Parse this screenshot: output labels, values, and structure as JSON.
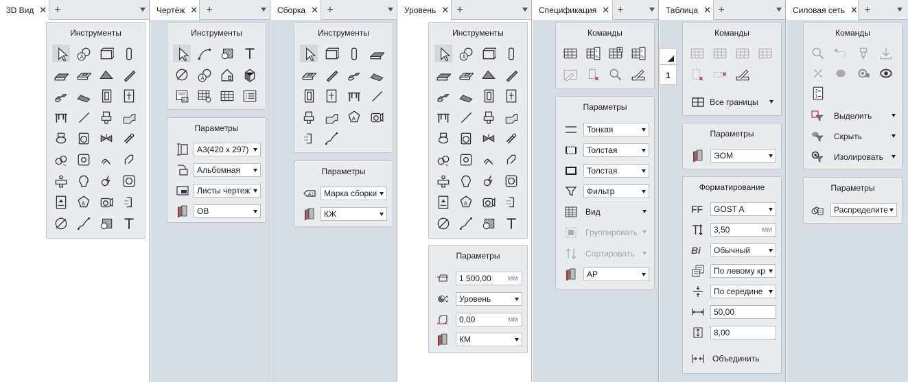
{
  "tabs": [
    {
      "label": "3D Вид"
    },
    {
      "label": "Чертёж"
    },
    {
      "label": "Сборка"
    },
    {
      "label": "Уровень"
    },
    {
      "label": "Спецификация"
    },
    {
      "label": "Таблица"
    },
    {
      "label": "Силовая сеть"
    }
  ],
  "common": {
    "close_glyph": "✕",
    "plus_glyph": "+",
    "instruments_title": "Инструменты",
    "params_title": "Параметры",
    "commands_title": "Команды",
    "formatting_title": "Форматирование"
  },
  "drawing_params": {
    "format": "А3(420 x 297)",
    "orientation": "Альбомная",
    "sheets": "Листы чертеж",
    "discipline": "ОВ"
  },
  "assembly_params": {
    "mark": "Марка сборки",
    "discipline": "КЖ"
  },
  "level_params": {
    "elevation": "1 500,00",
    "elevation_unit": "мм",
    "mode": "Уровень",
    "offset": "0,00",
    "offset_unit": "мм",
    "discipline": "КМ"
  },
  "spec_params": {
    "line1": "Тонкая",
    "line2": "Толстая",
    "line3": "Толстая",
    "filter": "Фильтр",
    "view": "Вид",
    "group": "Группировать",
    "sort": "Сортировать",
    "discipline": "АР"
  },
  "table": {
    "row_number": "1",
    "borders_label": "Все границы",
    "params_discipline": "ЭОМ",
    "font": "GOST A",
    "size": "3,50",
    "size_unit": "мм",
    "style": "Обычный",
    "halign": "По левому кр",
    "valign": "По середине",
    "width": "50,00",
    "height": "8,00",
    "merge_label": "Объединить",
    "ff_glyph": "FF",
    "bi_glyph": "Bi"
  },
  "power": {
    "select_label": "Выделить",
    "hide_label": "Скрыть",
    "isolate_label": "Изолировать",
    "params_value": "Распределите"
  },
  "colors": {
    "panel_gray": "#d6dce3",
    "card_bg": "#e9ecef",
    "tab_bar": "#e7eaee",
    "accent_magenta": "#c0307a",
    "accent_red": "#c8202a"
  }
}
